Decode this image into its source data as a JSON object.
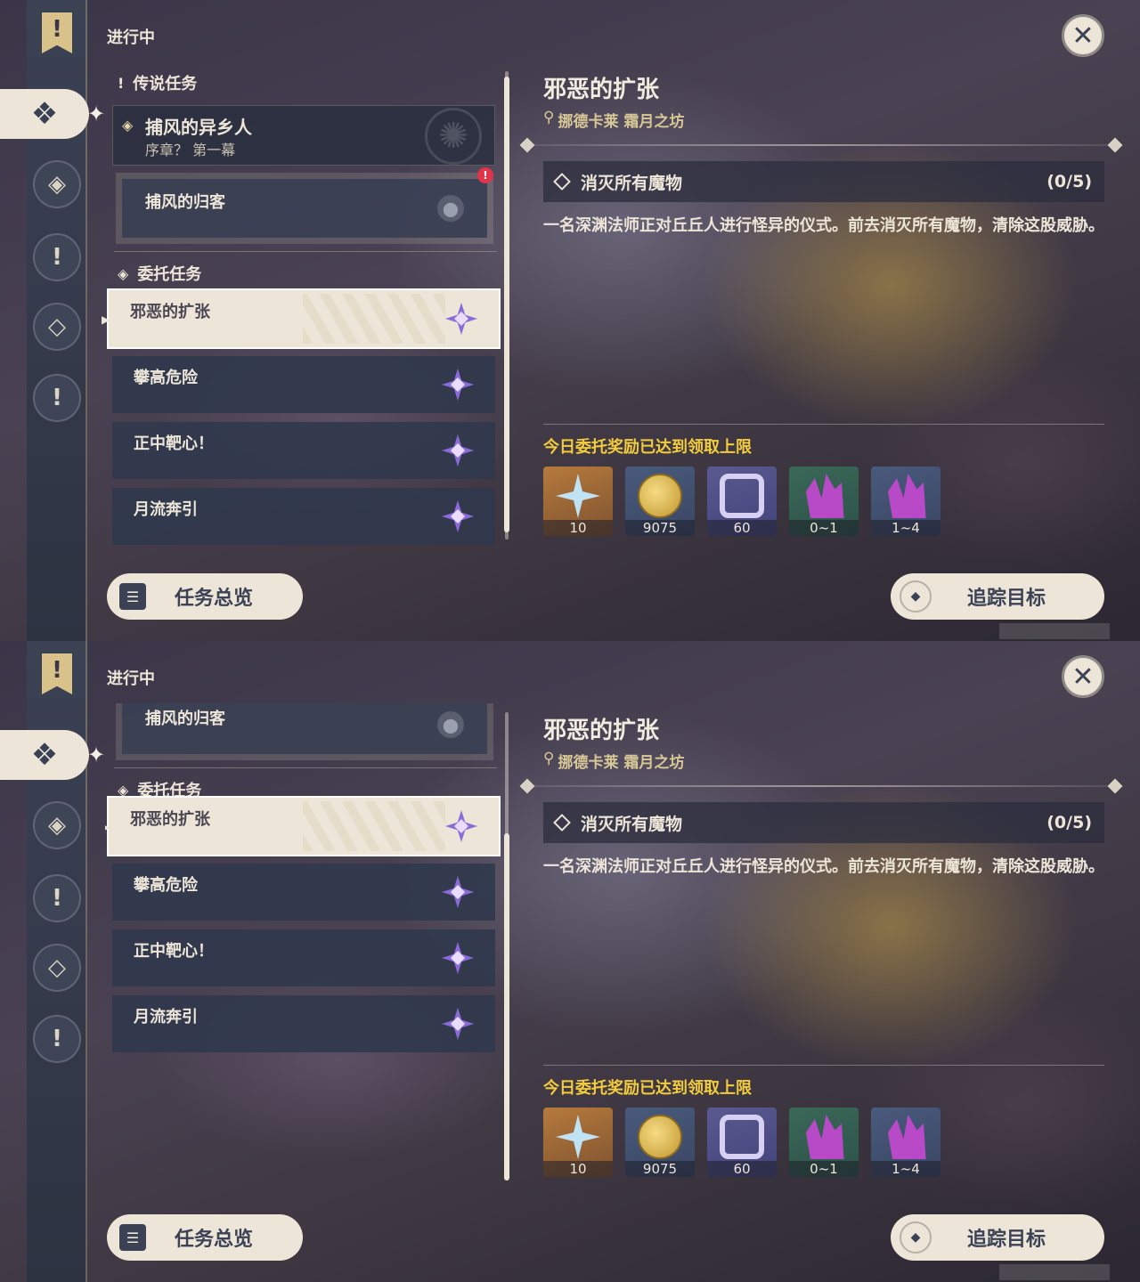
{
  "header": {
    "section": "进行中",
    "close_icon": "close-icon"
  },
  "archon": {
    "category": "传说任务",
    "quest_title": "捕风的异乡人",
    "quest_sub": "序章？ 第一幕",
    "subquest": "捕风的归客"
  },
  "commissions": {
    "category": "委托任务",
    "items": [
      {
        "label": "邪恶的扩张"
      },
      {
        "label": "攀高危险"
      },
      {
        "label": "正中靶心！"
      },
      {
        "label": "月流奔引"
      }
    ]
  },
  "detail": {
    "title": "邪恶的扩张",
    "location": "挪德卡莱 霜月之坊",
    "objective": "消灭所有魔物",
    "progress": "(0/5)",
    "description": "一名深渊法师正对丘丘人进行怪异的仪式。前去消灭所有魔物，清除这股威胁。",
    "reward_note": "今日委托奖励已达到领取上限",
    "rewards": [
      {
        "name": "primogem",
        "amount": "10"
      },
      {
        "name": "mora",
        "amount": "9075"
      },
      {
        "name": "adventure-exp",
        "amount": "60"
      },
      {
        "name": "crystal-small",
        "amount": "0~1"
      },
      {
        "name": "crystal-large",
        "amount": "1~4"
      }
    ]
  },
  "buttons": {
    "overview": "任务总览",
    "track": "追踪目标"
  },
  "colors": {
    "reward_note": "#f2cc3c",
    "gem": "#8a6bd8",
    "alert": "#e0344a"
  }
}
